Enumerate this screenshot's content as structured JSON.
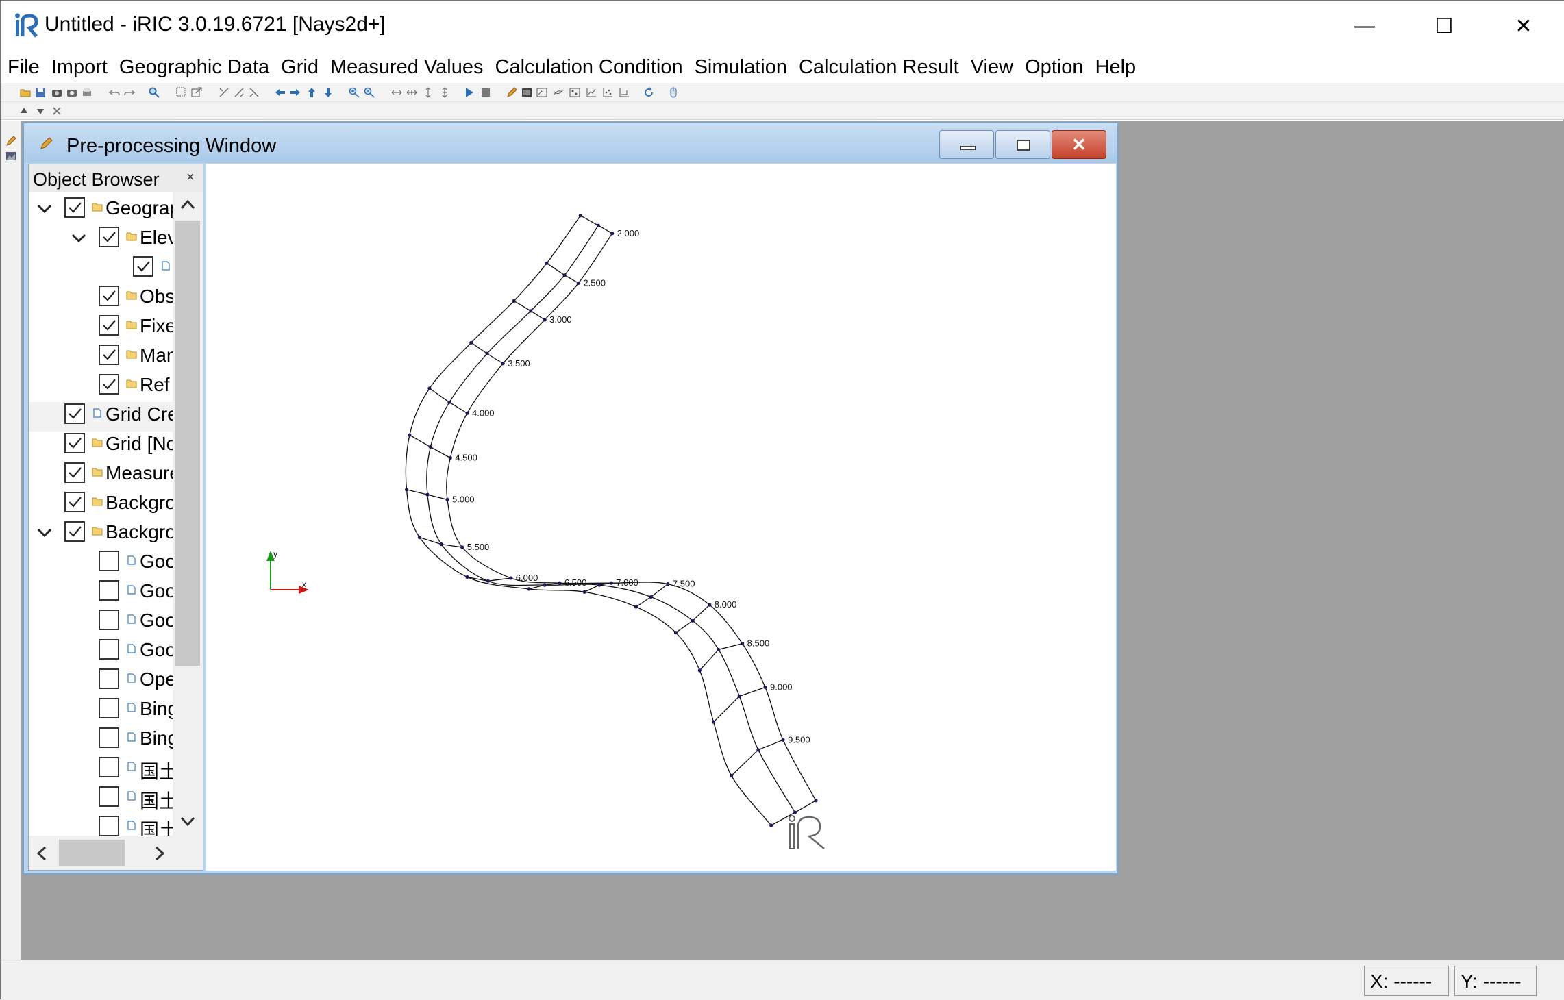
{
  "app": {
    "title": "Untitled - iRIC 3.0.19.6721 [Nays2d+]",
    "logo": "iric-logo-icon"
  },
  "window_controls": {
    "minimize": "—",
    "maximize": "☐",
    "close": "✕"
  },
  "menu": [
    "File",
    "Import",
    "Geographic Data",
    "Grid",
    "Measured Values",
    "Calculation Condition",
    "Simulation",
    "Calculation Result",
    "View",
    "Option",
    "Help"
  ],
  "pre_window": {
    "title": "Pre-processing Window",
    "close_glyph": "✕"
  },
  "object_browser": {
    "title": "Object Browser",
    "close": "×",
    "items": [
      {
        "label": "Geographic Data",
        "checked": true,
        "expanded": true,
        "level": 0,
        "icon": "folder-icon"
      },
      {
        "label": "Elevation",
        "checked": true,
        "expanded": true,
        "level": 1,
        "icon": "folder-icon"
      },
      {
        "label": "",
        "checked": true,
        "level": 2,
        "icon": "file-icon"
      },
      {
        "label": "Obstacle",
        "checked": true,
        "level": 1,
        "icon": "folder-icon"
      },
      {
        "label": "Fixed",
        "checked": true,
        "level": 1,
        "icon": "folder-icon"
      },
      {
        "label": "Manning",
        "checked": true,
        "level": 1,
        "icon": "folder-icon"
      },
      {
        "label": "Ref",
        "checked": true,
        "level": 1,
        "icon": "folder-icon"
      },
      {
        "label": "Grid Creating Condition",
        "checked": true,
        "level": 0,
        "icon": "file-icon",
        "selected": true
      },
      {
        "label": "Grid [No Data]",
        "checked": true,
        "level": 0,
        "icon": "folder-icon"
      },
      {
        "label": "Measured Values",
        "checked": true,
        "level": 0,
        "icon": "folder-icon"
      },
      {
        "label": "Background",
        "checked": true,
        "level": 0,
        "icon": "folder-icon"
      },
      {
        "label": "Background Images",
        "checked": true,
        "expanded": true,
        "level": 0,
        "icon": "folder-icon"
      },
      {
        "label": "Google",
        "checked": false,
        "level": 1,
        "icon": "file-icon"
      },
      {
        "label": "Google",
        "checked": false,
        "level": 1,
        "icon": "file-icon"
      },
      {
        "label": "Google",
        "checked": false,
        "level": 1,
        "icon": "file-icon"
      },
      {
        "label": "Google",
        "checked": false,
        "level": 1,
        "icon": "file-icon"
      },
      {
        "label": "Open",
        "checked": false,
        "level": 1,
        "icon": "file-icon"
      },
      {
        "label": "Bing",
        "checked": false,
        "level": 1,
        "icon": "file-icon"
      },
      {
        "label": "Bing",
        "checked": false,
        "level": 1,
        "icon": "file-icon"
      },
      {
        "label": "国土",
        "checked": false,
        "level": 1,
        "icon": "file-icon"
      },
      {
        "label": "国土",
        "checked": false,
        "level": 1,
        "icon": "file-icon"
      },
      {
        "label": "国土",
        "checked": false,
        "level": 1,
        "icon": "file-icon"
      }
    ]
  },
  "grid": {
    "center_line_labels": [
      "2.000",
      "2.500",
      "3.000",
      "3.500",
      "4.000",
      "4.500",
      "5.000",
      "5.500",
      "6.000",
      "6.500",
      "7.000",
      "7.500",
      "8.000",
      "8.500",
      "9.000",
      "9.500"
    ],
    "axis_labels": {
      "x": "x",
      "y": "y"
    },
    "watermark": "iric-logo-icon"
  },
  "status": {
    "x": "X: ------",
    "y": "Y: ------"
  }
}
